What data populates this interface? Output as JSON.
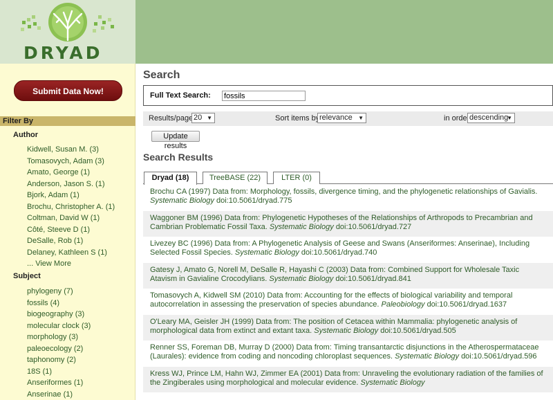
{
  "logo": {
    "word": "DRYAD"
  },
  "sidebar": {
    "submit_label": "Submit Data Now!",
    "filter_by": "Filter By",
    "author_heading": "Author",
    "authors": [
      "Kidwell, Susan M. (3)",
      "Tomasovych, Adam (3)",
      "Amato, George (1)",
      "Anderson, Jason S. (1)",
      "Bjork, Adam (1)",
      "Brochu, Christopher A. (1)",
      "Coltman, David W (1)",
      "Côté, Steeve D (1)",
      "DeSalle, Rob (1)",
      "Delaney, Kathleen S (1)",
      "... View More"
    ],
    "subject_heading": "Subject",
    "subjects": [
      "phylogeny (7)",
      "fossils (4)",
      "biogeography (3)",
      "molecular clock (3)",
      "morphology (3)",
      "paleoecology (2)",
      "taphonomy (2)",
      "18S (1)",
      "Anseriformes (1)",
      "Anserinae (1)"
    ]
  },
  "search": {
    "title": "Search",
    "fts_label": "Full Text Search:",
    "query": "fossils"
  },
  "controls": {
    "rpp_label": "Results/page",
    "rpp_value": "20",
    "sort_label": "Sort items by",
    "sort_value": "relevance",
    "order_label": "in order",
    "order_value": "descending",
    "update_label": "Update results"
  },
  "results_title": "Search Results",
  "tabs": [
    "Dryad (18)",
    "TreeBASE (22)",
    "LTER (0)"
  ],
  "results": [
    {
      "text": "Brochu CA (1997) Data from: Morphology, fossils, divergence timing, and the phylogenetic relationships of Gavialis.",
      "journal": "Systematic Biology",
      "doi": "doi:10.5061/dryad.775"
    },
    {
      "text": "Waggoner BM (1996) Data from: Phylogenetic Hypotheses of the Relationships of Arthropods to Precambrian and Cambrian Problematic Fossil Taxa.",
      "journal": "Systematic Biology",
      "doi": "doi:10.5061/dryad.727"
    },
    {
      "text": "Livezey BC (1996) Data from: A Phylogenetic Analysis of Geese and Swans (Anseriformes: Anserinae), Including Selected Fossil Species.",
      "journal": "Systematic Biology",
      "doi": "doi:10.5061/dryad.740"
    },
    {
      "text": "Gatesy J, Amato G, Norell M, DeSalle R, Hayashi C (2003) Data from: Combined Support for Wholesale Taxic Atavism in Gavialine Crocodylians.",
      "journal": "Systematic Biology",
      "doi": "doi:10.5061/dryad.841"
    },
    {
      "text": "Tomasovych A, Kidwell SM (2010) Data from: Accounting for the effects of biological variability and temporal autocorrelation in assessing the preservation of species abundance.",
      "journal": "Paleobiology",
      "doi": "doi:10.5061/dryad.1637"
    },
    {
      "text": "O'Leary MA, Geisler JH (1999) Data from: The position of Cetacea within Mammalia: phylogenetic analysis of morphological data from extinct and extant taxa.",
      "journal": "Systematic Biology",
      "doi": "doi:10.5061/dryad.505"
    },
    {
      "text": "Renner SS, Foreman DB, Murray D (2000) Data from: Timing transantarctic disjunctions in the Atherospermataceae (Laurales): evidence from coding and noncoding chloroplast sequences.",
      "journal": "Systematic Biology",
      "doi": "doi:10.5061/dryad.596"
    },
    {
      "text": "Kress WJ, Prince LM, Hahn WJ, Zimmer EA (2001) Data from: Unraveling the evolutionary radiation of the families of the Zingiberales using morphological and molecular evidence.",
      "journal": "Systematic Biology",
      "doi": ""
    }
  ]
}
